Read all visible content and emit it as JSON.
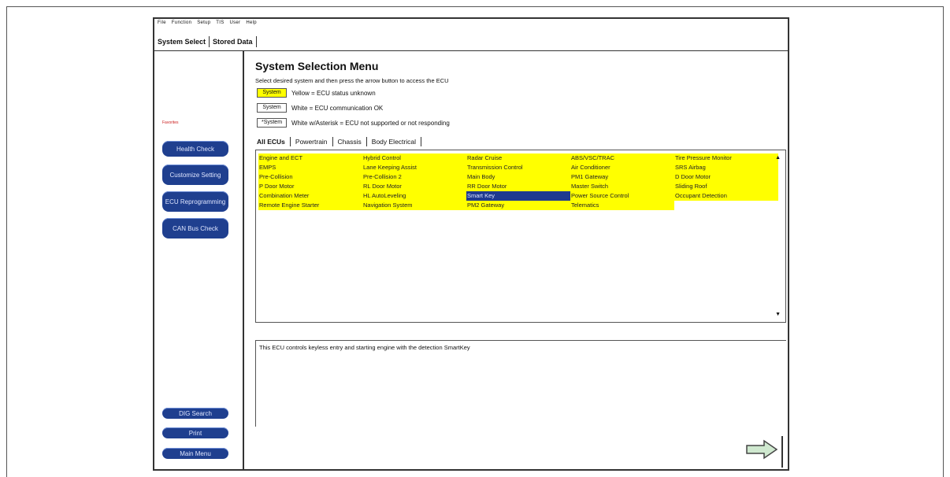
{
  "menubar": [
    "File",
    "Function",
    "Setup",
    "TIS",
    "User",
    "Help"
  ],
  "top_tabs": {
    "system_select": "System Select",
    "stored_data": "Stored Data"
  },
  "sidebar": {
    "red_label": "Favorites",
    "buttons": [
      "Health Check",
      "Customize Setting",
      "ECU Reprogramming",
      "CAN Bus Check"
    ],
    "bottom_buttons": [
      "DIG Search",
      "Print",
      "Main Menu"
    ]
  },
  "main": {
    "title": "System Selection Menu",
    "instruction": "Select desired system and then press the arrow button to access the ECU",
    "legend": [
      {
        "box": "System",
        "text": "Yellow = ECU status unknown"
      },
      {
        "box": "System",
        "text": "White = ECU communication OK"
      },
      {
        "box": "*System",
        "text": "White w/Asterisk = ECU not supported or not responding"
      }
    ],
    "ecu_tabs": [
      "All ECUs",
      "Powertrain",
      "Chassis",
      "Body Electrical"
    ],
    "ecu_rows": [
      [
        "Engine and ECT",
        "Hybrid Control",
        "Radar Cruise",
        "ABS/VSC/TRAC",
        "Tire Pressure Monitor"
      ],
      [
        "EMPS",
        "Lane Keeping Assist",
        "Transmission Control",
        "Air Conditioner",
        "SRS Airbag"
      ],
      [
        "Pre-Collision",
        "Pre-Collision 2",
        "Main Body",
        "PM1 Gateway",
        "D Door Motor"
      ],
      [
        "P Door Motor",
        "RL Door Motor",
        "RR Door Motor",
        "Master Switch",
        "Sliding Roof"
      ],
      [
        "Combination Meter",
        "HL AutoLeveling",
        "Smart Key",
        "Power Source Control",
        "Occupant Detection"
      ],
      [
        "Remote Engine Starter",
        "Navigation System",
        "PM2 Gateway",
        "Telematics",
        ""
      ]
    ],
    "selected_ecu": "Smart Key",
    "description": "This ECU controls keyless entry and starting engine with the detection SmartKey"
  },
  "colors": {
    "status_unknown": "#ffff00",
    "selected": "#1f3a8f",
    "button": "#1f3f8f"
  }
}
